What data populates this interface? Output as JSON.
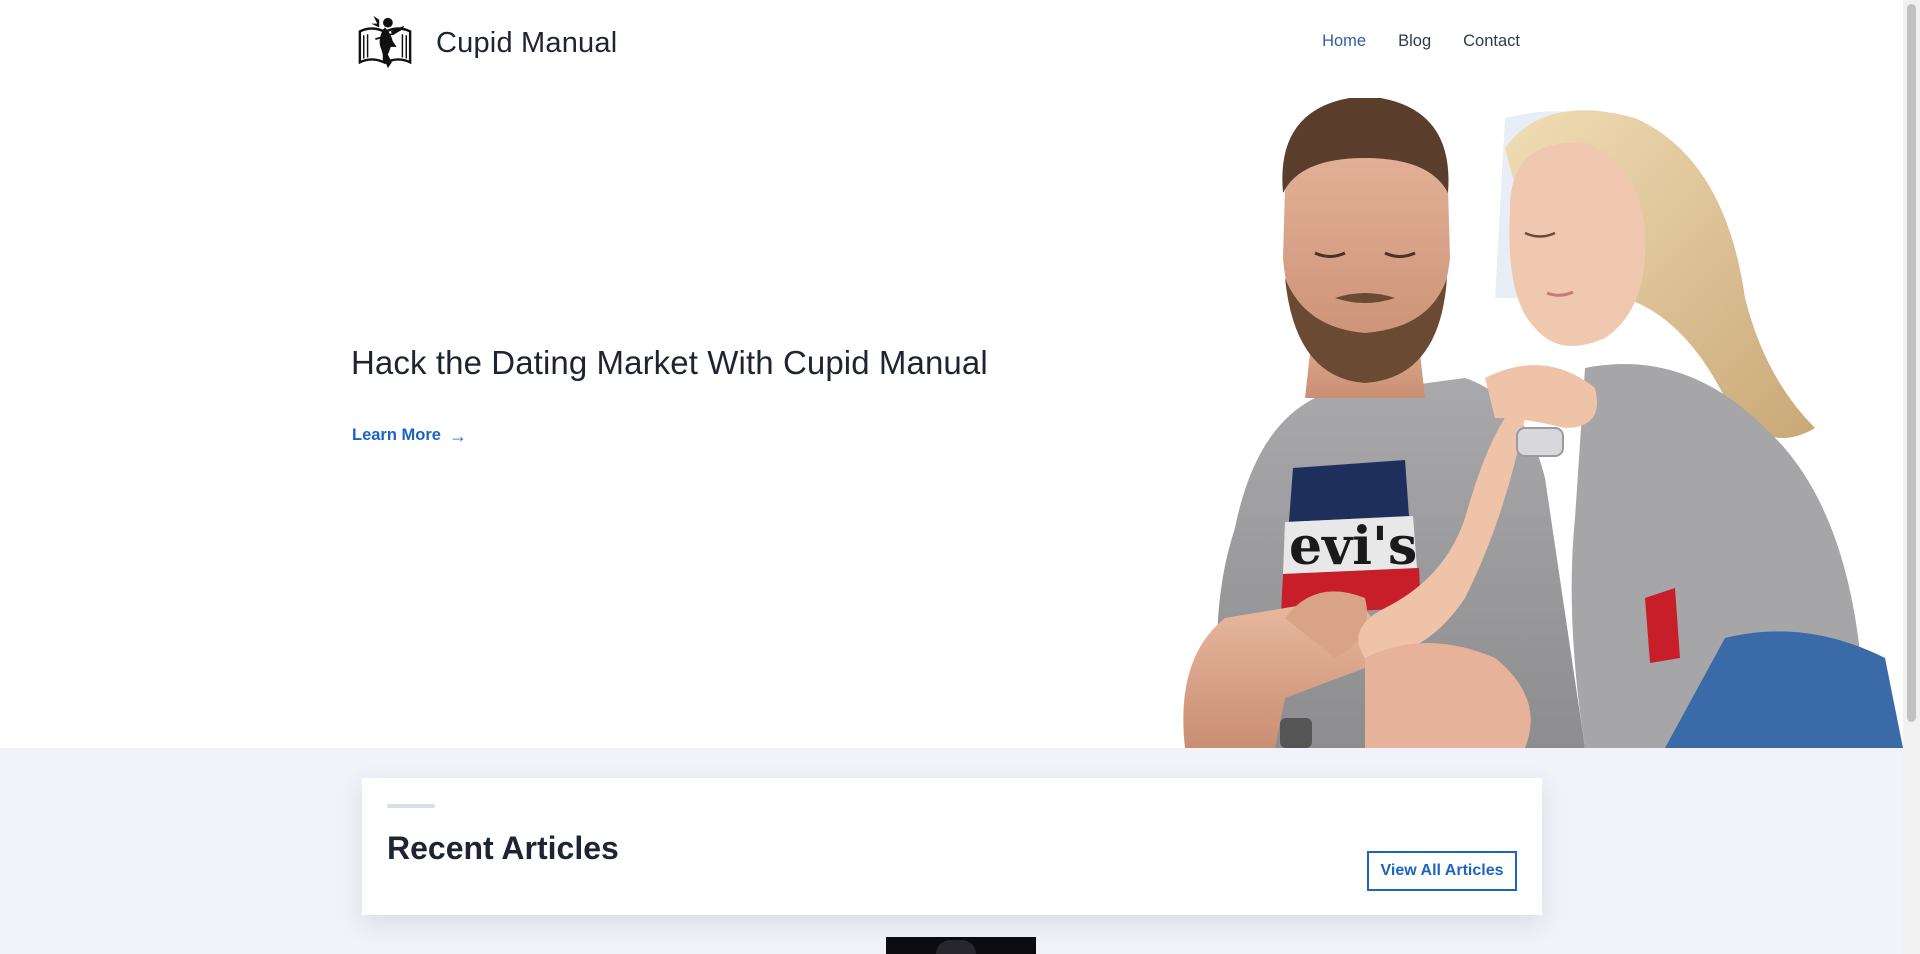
{
  "header": {
    "brand_name": "Cupid Manual",
    "logo_icon": "cupid-book-logo",
    "nav": [
      {
        "label": "Home",
        "active": true
      },
      {
        "label": "Blog",
        "active": false
      },
      {
        "label": "Contact",
        "active": false
      }
    ]
  },
  "hero": {
    "title": "Hack the Dating Market With Cupid Manual",
    "cta_label": "Learn More",
    "cta_icon": "arrow-right-icon",
    "image": "couple-photo"
  },
  "recent": {
    "title": "Recent Articles",
    "button_label": "View All Articles"
  },
  "colors": {
    "accent": "#1d64c2",
    "text": "#1f2433",
    "section_bg": "#f2f3f9"
  }
}
